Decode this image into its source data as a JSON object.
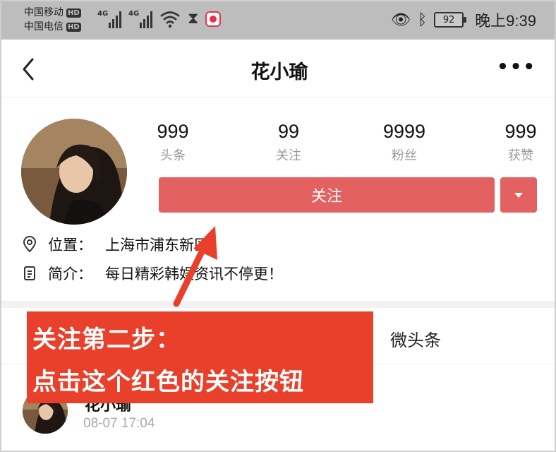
{
  "status_bar": {
    "carrier1": "中国移动",
    "carrier2": "中国电信",
    "hd_badge": "HD",
    "network1": "4G",
    "network2": "4G",
    "battery": "92",
    "time": "晚上9:39"
  },
  "header": {
    "title": "花小瑜"
  },
  "profile": {
    "stats": [
      {
        "value": "999",
        "label": "头条"
      },
      {
        "value": "99",
        "label": "关注"
      },
      {
        "value": "9999",
        "label": "粉丝"
      },
      {
        "value": "999",
        "label": "获赞"
      }
    ],
    "follow_label": "关注",
    "location_key": "位置：",
    "location_value": "上海市浦东新区",
    "bio_key": "简介：",
    "bio_value": "每日精彩韩娱资讯不停更！"
  },
  "tabs": {
    "weitoutiao": "微头条"
  },
  "post": {
    "author": "花小瑜",
    "time": "08-07 17:04"
  },
  "annotation": {
    "line1": "关注第二步：",
    "line2": "点击这个红色的关注按钮"
  },
  "colors": {
    "accent_red": "#e36161",
    "annotation_red": "#e8402a"
  }
}
